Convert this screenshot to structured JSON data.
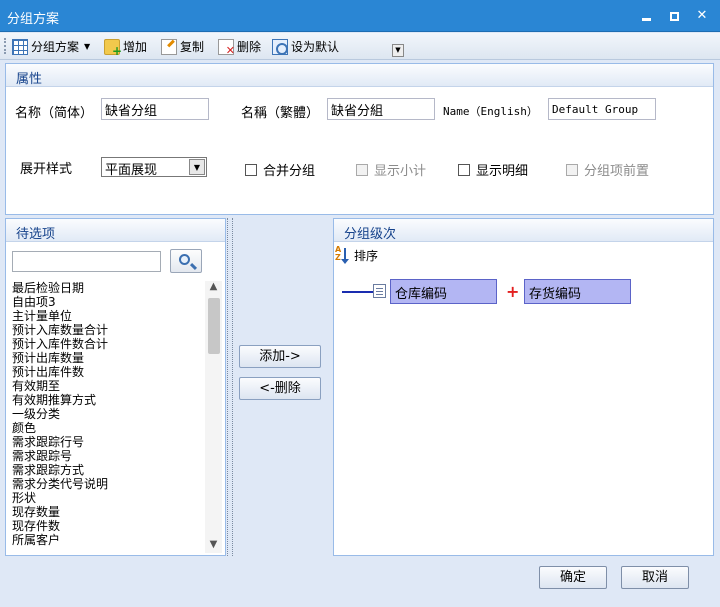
{
  "window": {
    "title": "分组方案"
  },
  "toolbar": {
    "scheme_label": "分组方案",
    "add_label": "增加",
    "copy_label": "复制",
    "delete_label": "删除",
    "default_label": "设为默认"
  },
  "properties": {
    "header": "属性",
    "name_simplified_label": "名称（简体）",
    "name_simplified_value": "缺省分组",
    "name_traditional_label": "名稱（繁體）",
    "name_traditional_value": "缺省分組",
    "name_english_label": "Name（English）",
    "name_english_value": "Default Group",
    "expand_style_label": "展开样式",
    "expand_style_value": "平面展现",
    "checkboxes": {
      "merge_group": "合并分组",
      "show_subtotal": "显示小计",
      "show_detail": "显示明细",
      "group_first": "分组项前置"
    }
  },
  "candidates": {
    "header": "待选项",
    "search_value": "",
    "items": [
      "最后检验日期",
      "自由项3",
      "主计量单位",
      "预计入库数量合计",
      "预计入库件数合计",
      "预计出库数量",
      "预计出库件数",
      "有效期至",
      "有效期推算方式",
      "一级分类",
      "颜色",
      "需求跟踪行号",
      "需求跟踪号",
      "需求跟踪方式",
      "需求分类代号说明",
      "形状",
      "现存数量",
      "现存件数",
      "所属客户"
    ]
  },
  "middle": {
    "add_button": "添加->",
    "remove_button": "<-删除"
  },
  "group_levels": {
    "header": "分组级次",
    "sort_label": "排序",
    "nodes": [
      "仓库编码",
      "存货编码"
    ]
  },
  "footer": {
    "ok_button": "确定",
    "cancel_button": "取消"
  }
}
